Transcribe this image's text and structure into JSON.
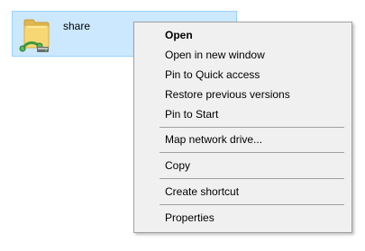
{
  "folder": {
    "name": "share",
    "icon": "shared-folder-icon",
    "selection_bg": "#cce8ff",
    "selection_border": "#99d1ff"
  },
  "context_menu": {
    "items": [
      {
        "label": "Open",
        "bold": true
      },
      {
        "label": "Open in new window"
      },
      {
        "label": "Pin to Quick access"
      },
      {
        "label": "Restore previous versions"
      },
      {
        "label": "Pin to Start"
      },
      {
        "label": "Map network drive..."
      },
      {
        "label": "Copy"
      },
      {
        "label": "Create shortcut"
      },
      {
        "label": "Properties"
      }
    ]
  }
}
